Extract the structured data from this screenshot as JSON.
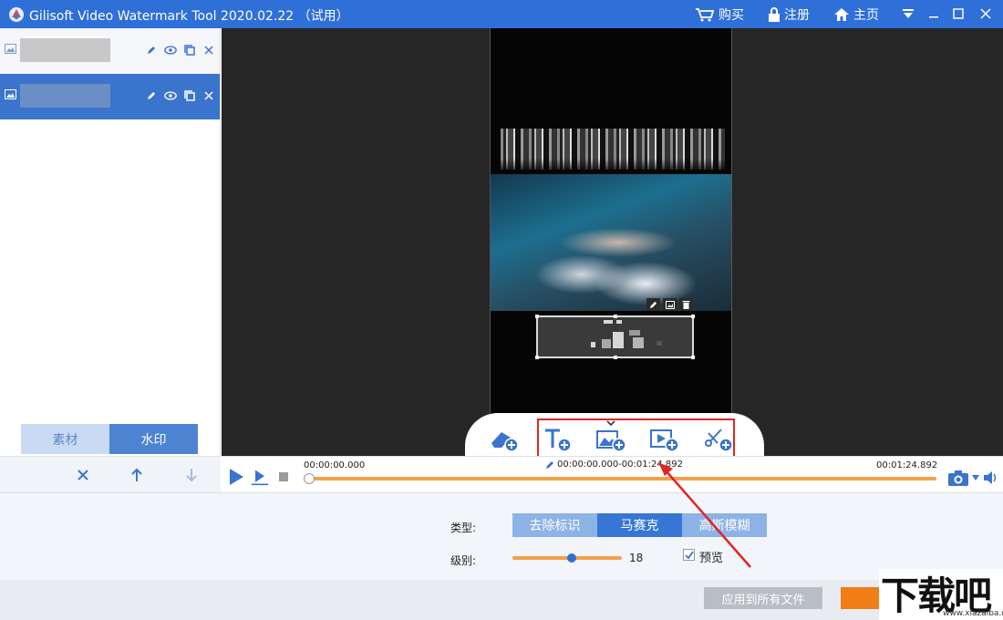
{
  "titlebar": {
    "title": "Gilisoft Video Watermark Tool 2020.02.22 （试用）",
    "buy": "购买",
    "register": "注册",
    "home": "主页",
    "icons": [
      "cart-icon",
      "lock-icon",
      "home-icon",
      "menu-icon",
      "minimize-icon",
      "maximize-icon",
      "close-icon"
    ]
  },
  "sidebar": {
    "tabs": [
      {
        "label": "素材",
        "active": false
      },
      {
        "label": "水印",
        "active": true
      }
    ],
    "items": [
      {
        "name": "watermark-item-1",
        "selected": false
      },
      {
        "name": "watermark-item-2",
        "selected": true
      }
    ]
  },
  "timeline": {
    "start": "00:00:00.000",
    "range": "00:00:00.000-00:01:24.892",
    "end": "00:01:24.892",
    "progress": 0.0
  },
  "settings": {
    "type_label": "类型:",
    "types": [
      "去除标识",
      "马赛克",
      "高斯模糊"
    ],
    "selected_type": "马赛克",
    "level_label": "级别:",
    "level_value": "18",
    "level_fraction": 0.54,
    "preview_label": "预览",
    "preview_checked": true,
    "apply_all": "应用到所有文件"
  },
  "logo": {
    "text": "下载吧",
    "url": "www.xiazaiba.com"
  },
  "colors": {
    "accent": "#2f6fd8",
    "progress": "#f5a14a",
    "highlight": "#e22424"
  }
}
